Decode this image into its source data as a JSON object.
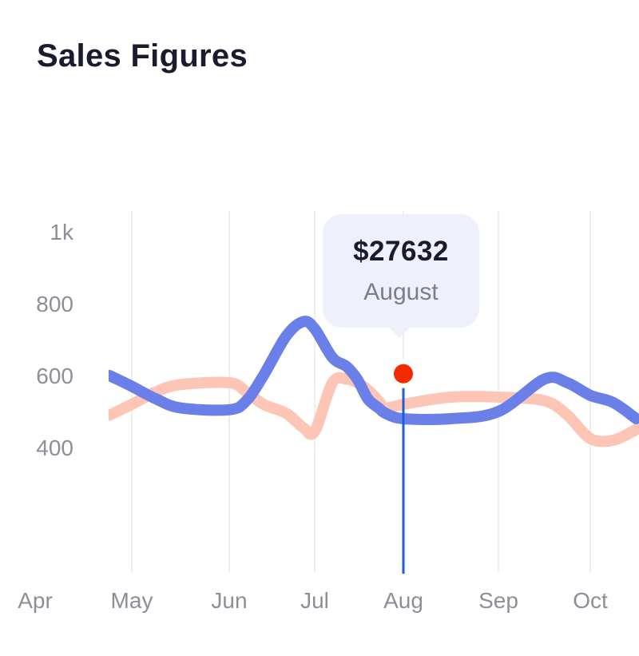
{
  "header": {
    "title": "Sales Figures"
  },
  "tooltip": {
    "value": "$27632",
    "label": "August"
  },
  "colors": {
    "series_blue": "#6b7fe8",
    "series_peach": "#fcc5b5",
    "marker": "#f22c00",
    "cursor_line": "#1f5fd6",
    "grid": "#eeeeee",
    "tick_text": "#8e8e98"
  },
  "chart_data": {
    "type": "line",
    "title": "Sales Figures",
    "xlabel": "",
    "ylabel": "",
    "categories": [
      "Apr",
      "May",
      "Jun",
      "Jul",
      "Aug",
      "Sep",
      "Oct"
    ],
    "y_ticks": [
      "1k",
      "800",
      "600",
      "400"
    ],
    "y_tick_values": [
      1000,
      800,
      600,
      400
    ],
    "ylim": [
      200,
      1000
    ],
    "grid": "vertical",
    "x": [
      2.77,
      3.0,
      3.25,
      3.5,
      4.0,
      4.3,
      4.6,
      5.0,
      5.3,
      5.5,
      6.0,
      6.4,
      6.7,
      7.0,
      7.3,
      7.5,
      8.0,
      8.5,
      9.0,
      9.5,
      9.75,
      10.0,
      10.25,
      10.5
    ],
    "series": [
      {
        "values": [
          600,
          570,
          535,
          510,
          505,
          530,
          600,
          710,
          750,
          730,
          650,
          625,
          590,
          535,
          510,
          495,
          480,
          480,
          500,
          590,
          580,
          545,
          525,
          480
        ]
      },
      {
        "values": [
          490,
          520,
          555,
          575,
          580,
          555,
          520,
          495,
          455,
          445,
          580,
          590,
          580,
          560,
          530,
          510,
          520,
          540,
          540,
          530,
          490,
          425,
          420,
          450
        ]
      }
    ],
    "highlight": {
      "x": 8.0,
      "category": "Aug",
      "series_index": 0,
      "value": 605
    }
  }
}
